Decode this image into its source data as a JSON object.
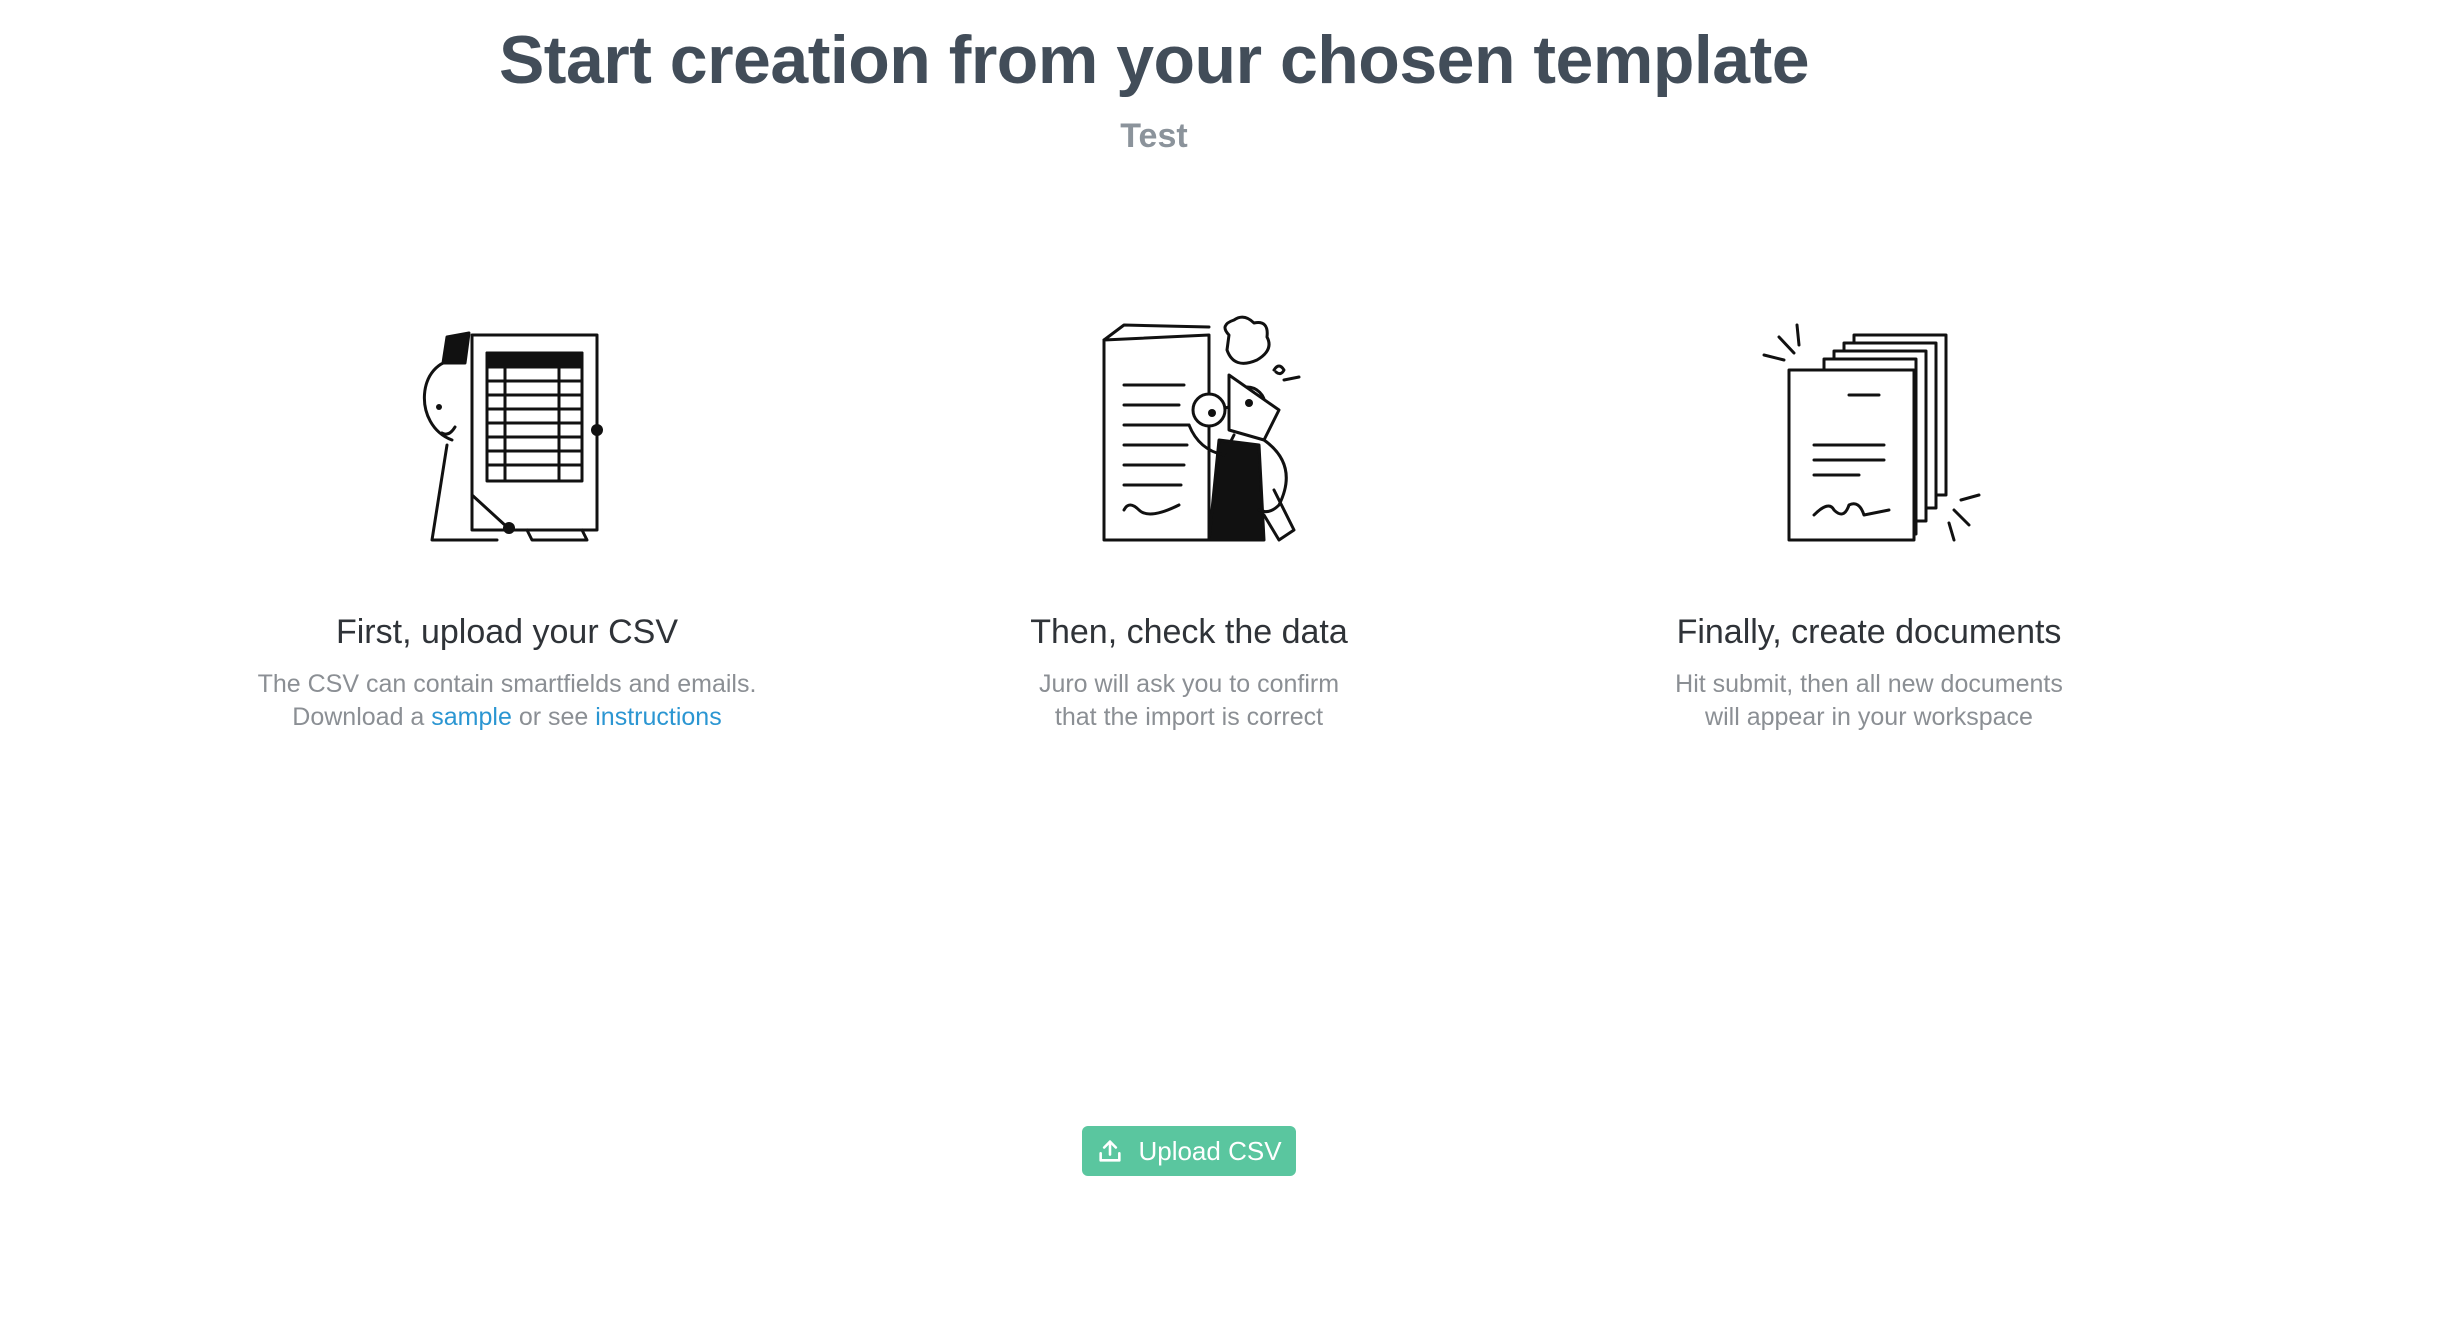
{
  "header": {
    "title": "Start creation from your chosen template",
    "subtitle": "Test"
  },
  "steps": [
    {
      "title": "First, upload your CSV",
      "desc_line1": "The CSV can contain smartfields and emails.",
      "desc_prefix": "Download a ",
      "sample_link": "sample",
      "desc_middle": " or see ",
      "instructions_link": "instructions",
      "icon": "spreadsheet-character-illustration"
    },
    {
      "title": "Then, check the data",
      "desc_line1": "Juro will ask you to confirm",
      "desc_line2": "that the import is correct",
      "icon": "reviewer-character-illustration"
    },
    {
      "title": "Finally, create documents",
      "desc_line1": "Hit submit, then all new documents",
      "desc_line2": "will appear in your workspace",
      "icon": "document-stack-illustration"
    }
  ],
  "upload_button": {
    "label": "Upload CSV",
    "icon": "upload-icon",
    "color": "#5ac69f"
  }
}
